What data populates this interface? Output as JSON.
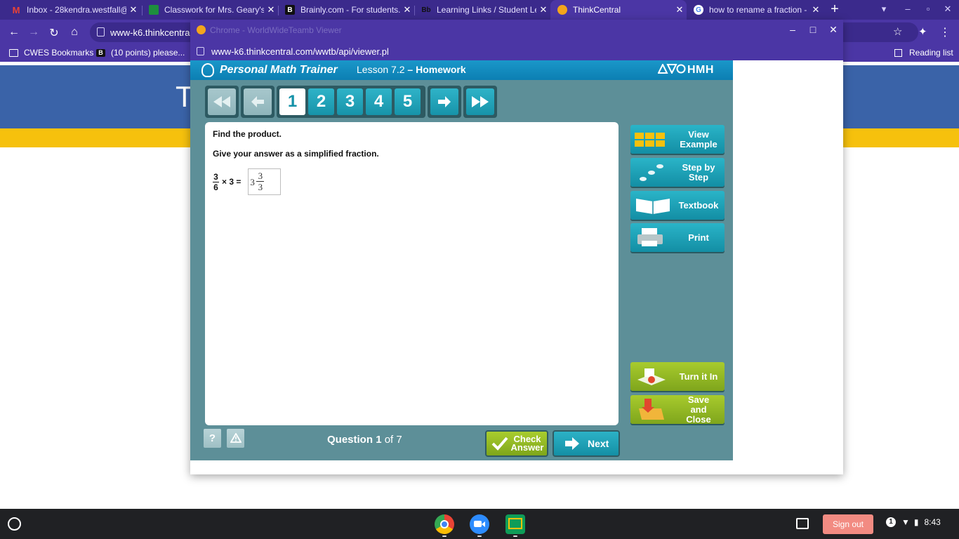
{
  "browser": {
    "tabs": [
      {
        "title": "Inbox - 28kendra.westfall@",
        "icon": "gmail-icon",
        "color": "#ea4335"
      },
      {
        "title": "Classwork for Mrs. Geary's c",
        "icon": "classroom-icon",
        "color": "#1e8e3e"
      },
      {
        "title": "Brainly.com - For students.",
        "icon": "brainly-icon",
        "color": "#111111"
      },
      {
        "title": "Learning Links / Student Le",
        "icon": "blackboard-icon",
        "color": "#111111"
      },
      {
        "title": "ThinkCentral",
        "icon": "thinkcentral-icon",
        "color": "#f4a51c"
      },
      {
        "title": "how to rename a fraction - G",
        "icon": "google-icon",
        "color": "#4285f4"
      }
    ],
    "url": "www-k6.thinkcentral",
    "bookmarks": [
      {
        "label": "CWES Bookmarks",
        "icon": "folder-icon"
      },
      {
        "label": "(10 points) please...",
        "icon": "brainly-icon"
      }
    ],
    "reading_list": "Reading list",
    "page_letter": "T"
  },
  "popup": {
    "title": "Chrome - WorldWideTeamb Viewer",
    "url": "www-k6.thinkcentral.com/wwtb/api/viewer.pl"
  },
  "app": {
    "brand": "Personal Math Trainer",
    "lesson": "Lesson 7.2",
    "lesson_sep": " – ",
    "lesson_type": "Homework",
    "publisher": "HMH",
    "question_numbers": [
      "1",
      "2",
      "3",
      "4",
      "5"
    ],
    "question": {
      "instruction": "Find the product.",
      "sub_instruction": "Give your answer as a simplified fraction.",
      "frac_num": "3",
      "frac_den": "6",
      "times": "× 3 =",
      "answer_whole": "3",
      "answer_num": "3",
      "answer_den": "3"
    },
    "side_buttons": {
      "view_example": "View Example",
      "step_by_step": "Step by Step",
      "textbook": "Textbook",
      "print": "Print",
      "turn_in": "Turn it In",
      "save_close": "Save and Close"
    },
    "footer": {
      "help": "?",
      "warning": "!",
      "question_label": "Question",
      "current": "1",
      "of_label": "of",
      "total": "7",
      "check_answer": "Check Answer",
      "next": "Next"
    }
  },
  "shelf": {
    "sign_out": "Sign out",
    "notification_count": "1",
    "time": "8:43"
  },
  "colors": {
    "chrome_purple": "#4b36a5",
    "app_teal": "#1793a9",
    "app_green": "#7fa51c"
  }
}
